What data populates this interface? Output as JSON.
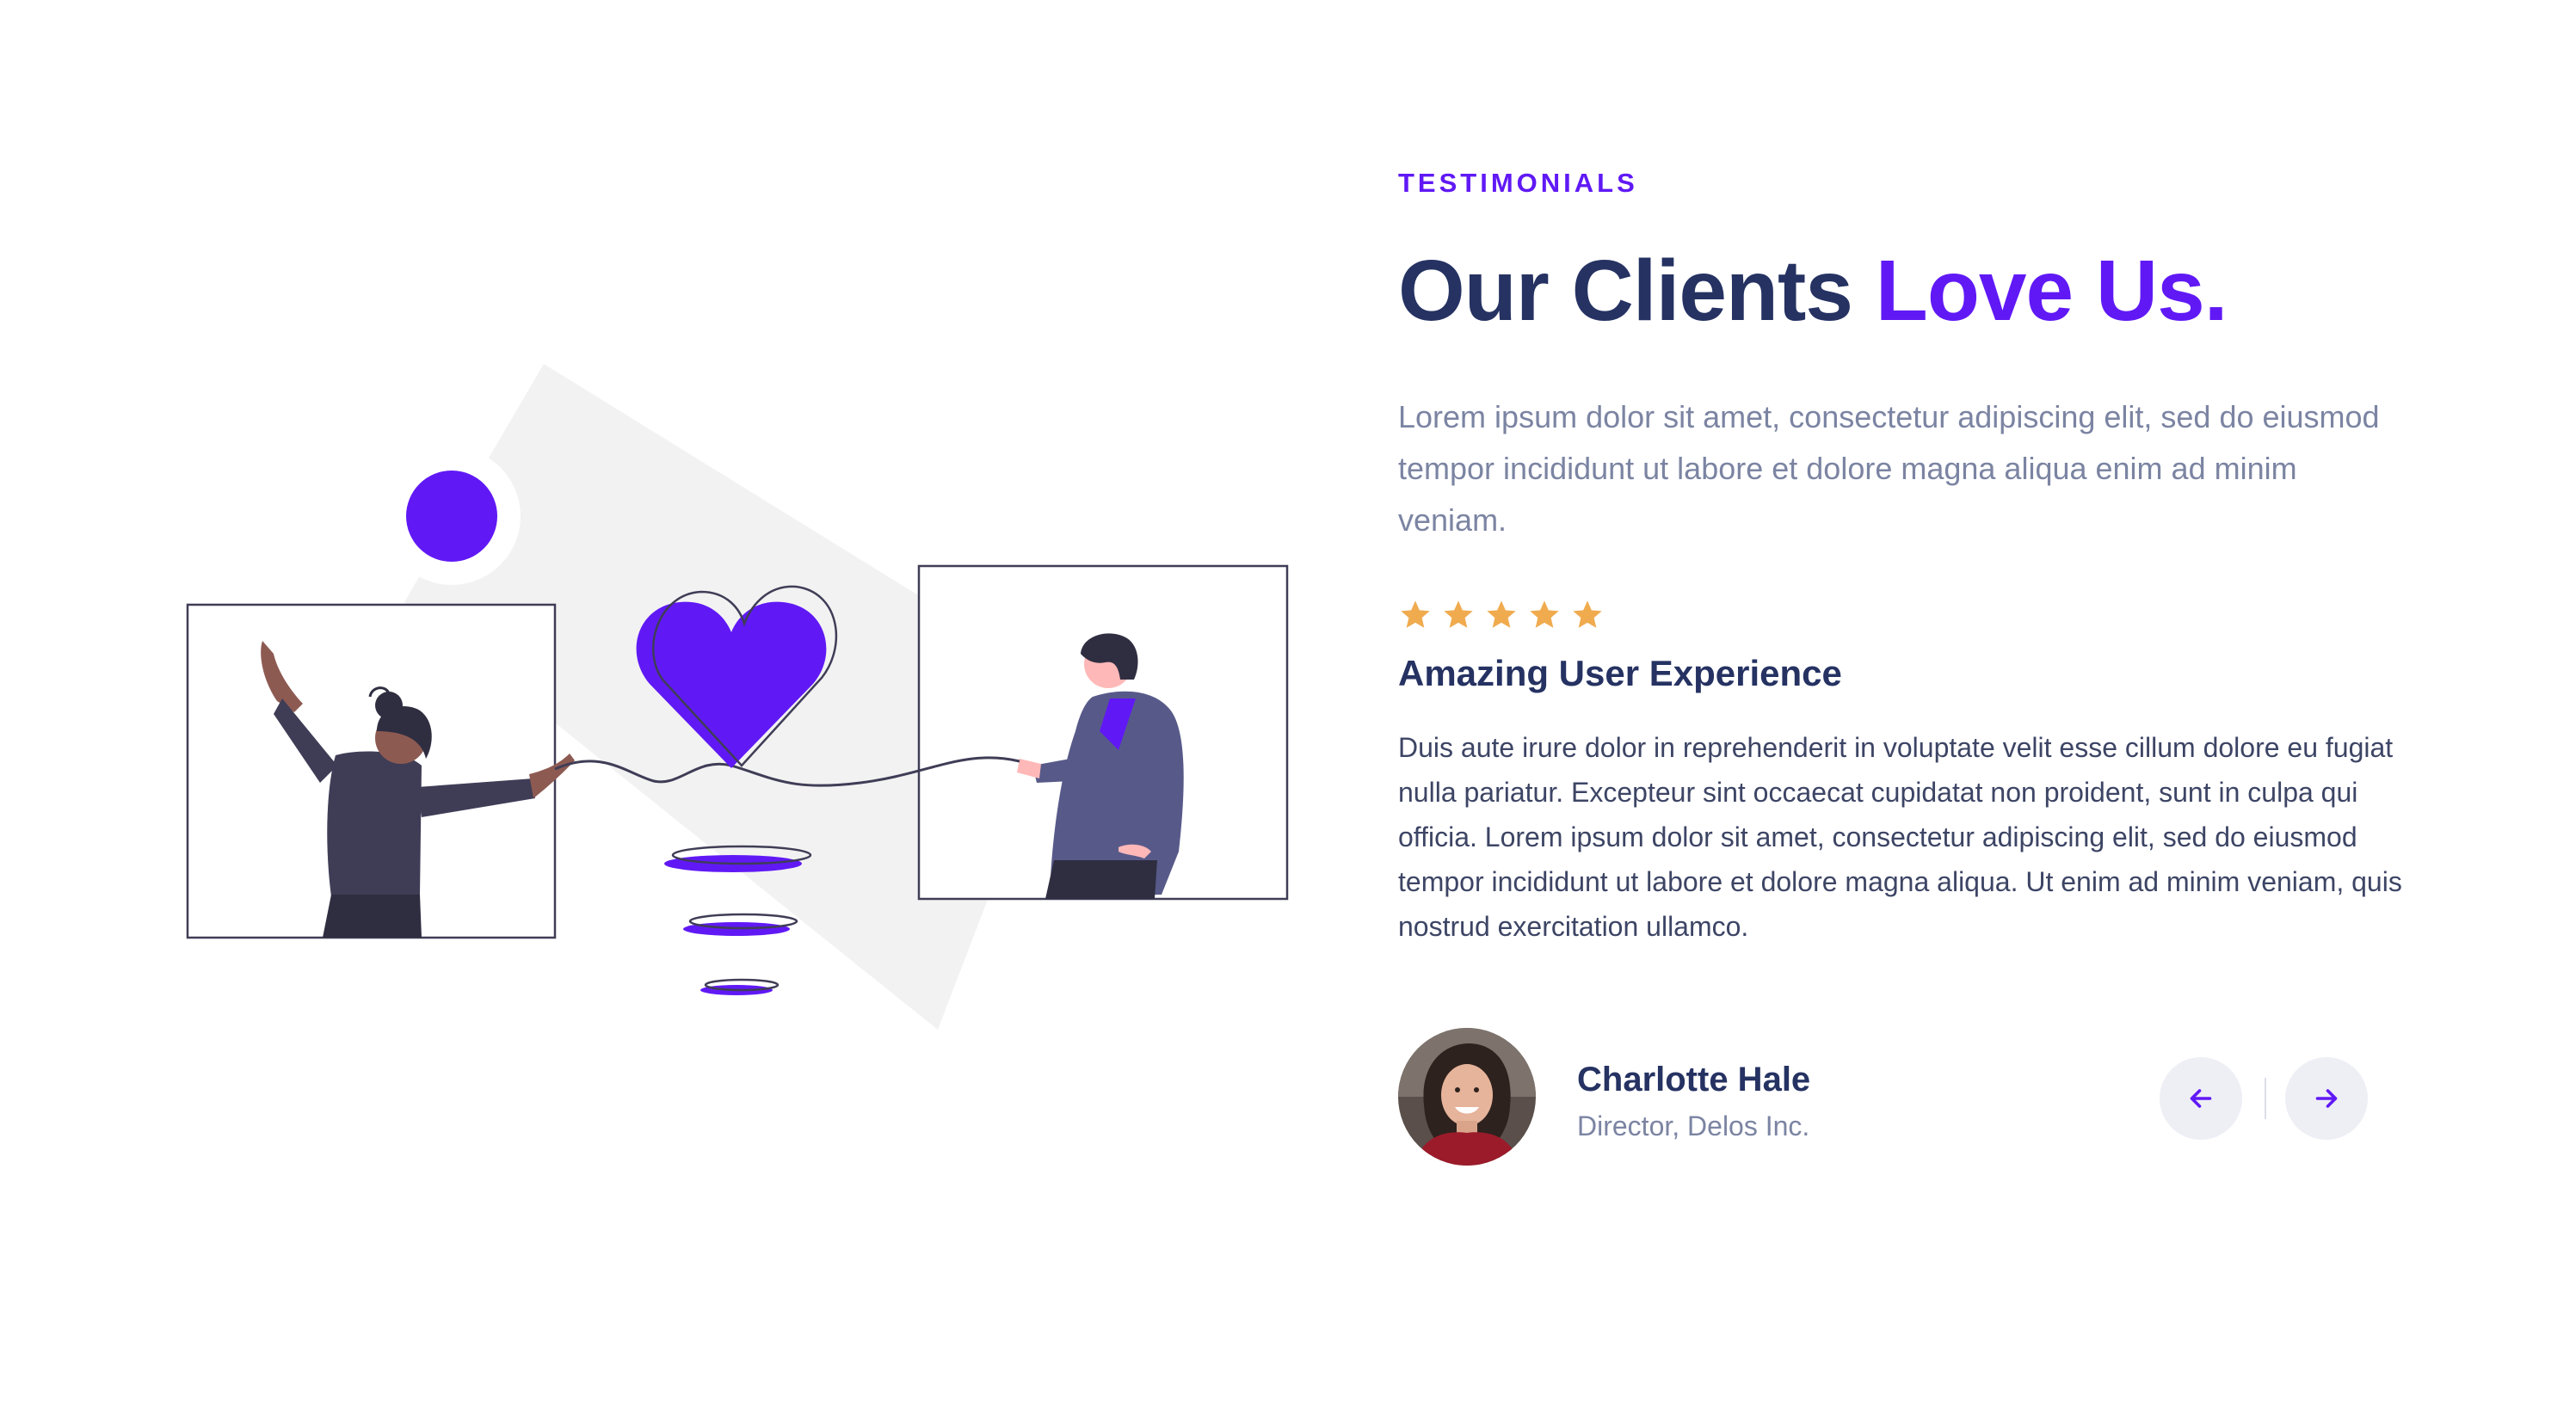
{
  "section": {
    "eyebrow": "TESTIMONIALS",
    "headline_main": "Our Clients ",
    "headline_accent": "Love Us.",
    "intro": "Lorem ipsum dolor sit amet, consectetur adipiscing elit, sed do eiusmod tempor incididunt ut labore et dolore magna aliqua enim ad minim veniam."
  },
  "testimonial": {
    "rating": 5,
    "rating_max": 5,
    "title": "Amazing User Experience",
    "body": "Duis aute irure dolor in reprehenderit in voluptate velit esse cillum dolore eu fugiat nulla pariatur. Excepteur sint occaecat cupidatat non proident, sunt in culpa qui officia. Lorem ipsum dolor sit amet, consectetur adipiscing elit, sed do eiusmod tempor incididunt ut labore et dolore magna aliqua. Ut enim ad minim veniam, quis nostrud exercitation ullamco.",
    "author_name": "Charlotte Hale",
    "author_role": "Director, Delos Inc."
  },
  "navigation": {
    "prev_icon": "arrow-left-icon",
    "next_icon": "arrow-right-icon"
  },
  "colors": {
    "accent": "#6019f5",
    "heading": "#253262",
    "muted": "#7b84a2",
    "body": "#3d4565",
    "star": "#f0ab4f",
    "nav_bg": "#eeeff5"
  }
}
